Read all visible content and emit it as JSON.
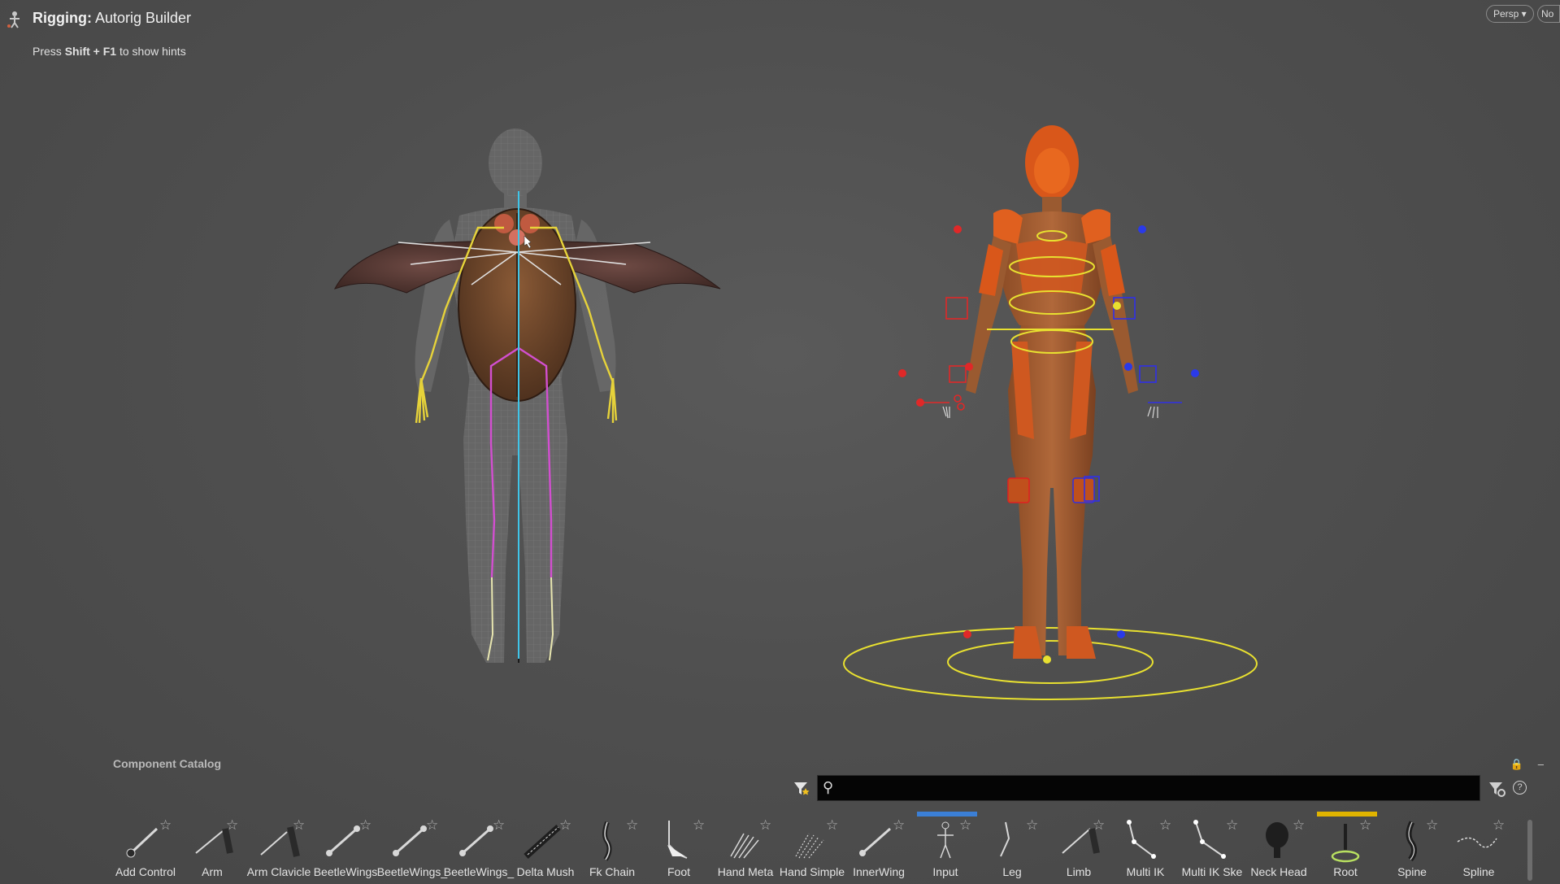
{
  "header": {
    "title_bold": "Rigging:",
    "title_rest": " Autorig Builder",
    "hint_prefix": "Press ",
    "hint_keys": "Shift + F1",
    "hint_suffix": " to show hints"
  },
  "view_buttons": {
    "persp": "Persp ▾",
    "no": "No"
  },
  "catalog": {
    "title": "Component Catalog",
    "search_value": "",
    "items": [
      {
        "label": "Add Control",
        "icon": "add-control-icon"
      },
      {
        "label": "Arm",
        "icon": "arm-icon"
      },
      {
        "label": "Arm Clavicle",
        "icon": "arm-clavicle-icon"
      },
      {
        "label": "BeetleWings",
        "icon": "beetlewings-icon"
      },
      {
        "label": "BeetleWings_",
        "icon": "beetlewings-alt-icon"
      },
      {
        "label": "BeetleWings_",
        "icon": "beetlewings-alt2-icon"
      },
      {
        "label": "Delta Mush",
        "icon": "delta-mush-icon"
      },
      {
        "label": "Fk Chain",
        "icon": "fk-chain-icon"
      },
      {
        "label": "Foot",
        "icon": "foot-icon"
      },
      {
        "label": "Hand Meta",
        "icon": "hand-meta-icon"
      },
      {
        "label": "Hand Simple",
        "icon": "hand-simple-icon"
      },
      {
        "label": "InnerWing",
        "icon": "innerwing-icon"
      },
      {
        "label": "Input",
        "icon": "input-icon",
        "bar_color": "#3b7fd6"
      },
      {
        "label": "Leg",
        "icon": "leg-icon"
      },
      {
        "label": "Limb",
        "icon": "limb-icon"
      },
      {
        "label": "Multi IK",
        "icon": "multi-ik-icon"
      },
      {
        "label": "Multi IK Ske",
        "icon": "multi-ik-skeleton-icon"
      },
      {
        "label": "Neck Head",
        "icon": "neck-head-icon"
      },
      {
        "label": "Root",
        "icon": "root-icon",
        "bar_color": "#e0b400"
      },
      {
        "label": "Spine",
        "icon": "spine-icon"
      },
      {
        "label": "Spline",
        "icon": "spline-icon"
      }
    ]
  },
  "colors": {
    "accent_blue": "#3b7fd6",
    "accent_yellow": "#e0b400",
    "rig_orange": "#d9571a",
    "control_yellow": "#e8e030"
  }
}
